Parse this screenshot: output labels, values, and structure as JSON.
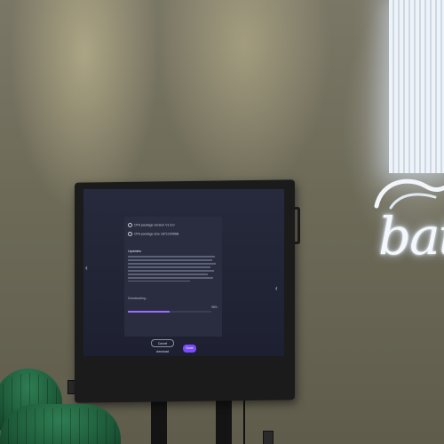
{
  "scene": {
    "sign_text": "bath",
    "tv_screen": {
      "package_rows": [
        {
          "label": "OTA package version V1.6.0"
        },
        {
          "label": "OTA package size 187123456B"
        }
      ],
      "update_title": "Updates",
      "download_label": "Downloading...",
      "download_percent": "98%",
      "download_progress": 0.5,
      "cancel_label": "Cancel download",
      "done_label": "Done",
      "left_arrow": "‹",
      "right_arrow": "‹"
    },
    "colors": {
      "wall": "#6f6a5a",
      "screen_bg": "#1d2030",
      "accent_button": "#7a4bff",
      "chair_green": "#1d5a39",
      "sign_glow": "#eef3f8"
    }
  }
}
